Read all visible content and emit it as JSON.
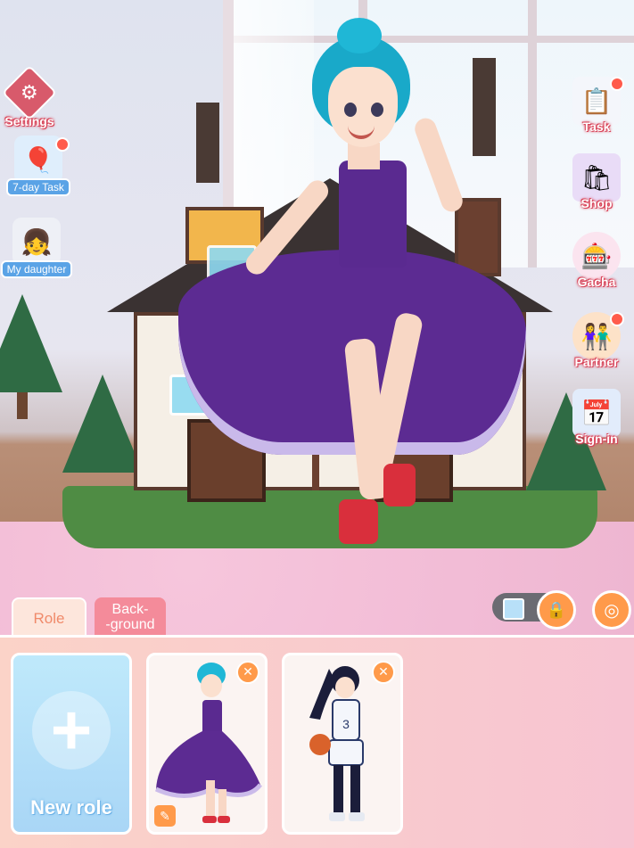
{
  "side_menu": {
    "settings": {
      "label": "Settings",
      "icon": "gear-icon"
    },
    "seven_day_task": {
      "label": "7-day Task",
      "icon": "balloons-calendar-icon"
    },
    "my_daughter": {
      "label": "My daughter",
      "icon": "daughter-avatar-icon"
    }
  },
  "right_menu": {
    "task": {
      "label": "Task",
      "icon": "clipboard-icon"
    },
    "shop": {
      "label": "Shop",
      "icon": "shopping-bag-icon"
    },
    "gacha": {
      "label": "Gacha",
      "icon": "gacha-machine-icon"
    },
    "partner": {
      "label": "Partner",
      "icon": "partner-couple-icon"
    },
    "sign_in": {
      "label": "Sign-in",
      "icon": "calendar-icon"
    }
  },
  "tabs": {
    "role": "Role",
    "background_line1": "Back-",
    "background_line2": "-ground"
  },
  "cards": {
    "new_role_label": "New role",
    "new_role_icon": "plus-icon",
    "role1": {
      "outfit": "purple-dress-character"
    },
    "role2": {
      "outfit": "basketball-uniform-character",
      "jersey_number": "3"
    }
  },
  "colors": {
    "accent_orange": "#ff9a4a",
    "label_pink": "#d9455a",
    "active_tab": "#fde6dc",
    "inactive_tab": "#f48b9a"
  }
}
